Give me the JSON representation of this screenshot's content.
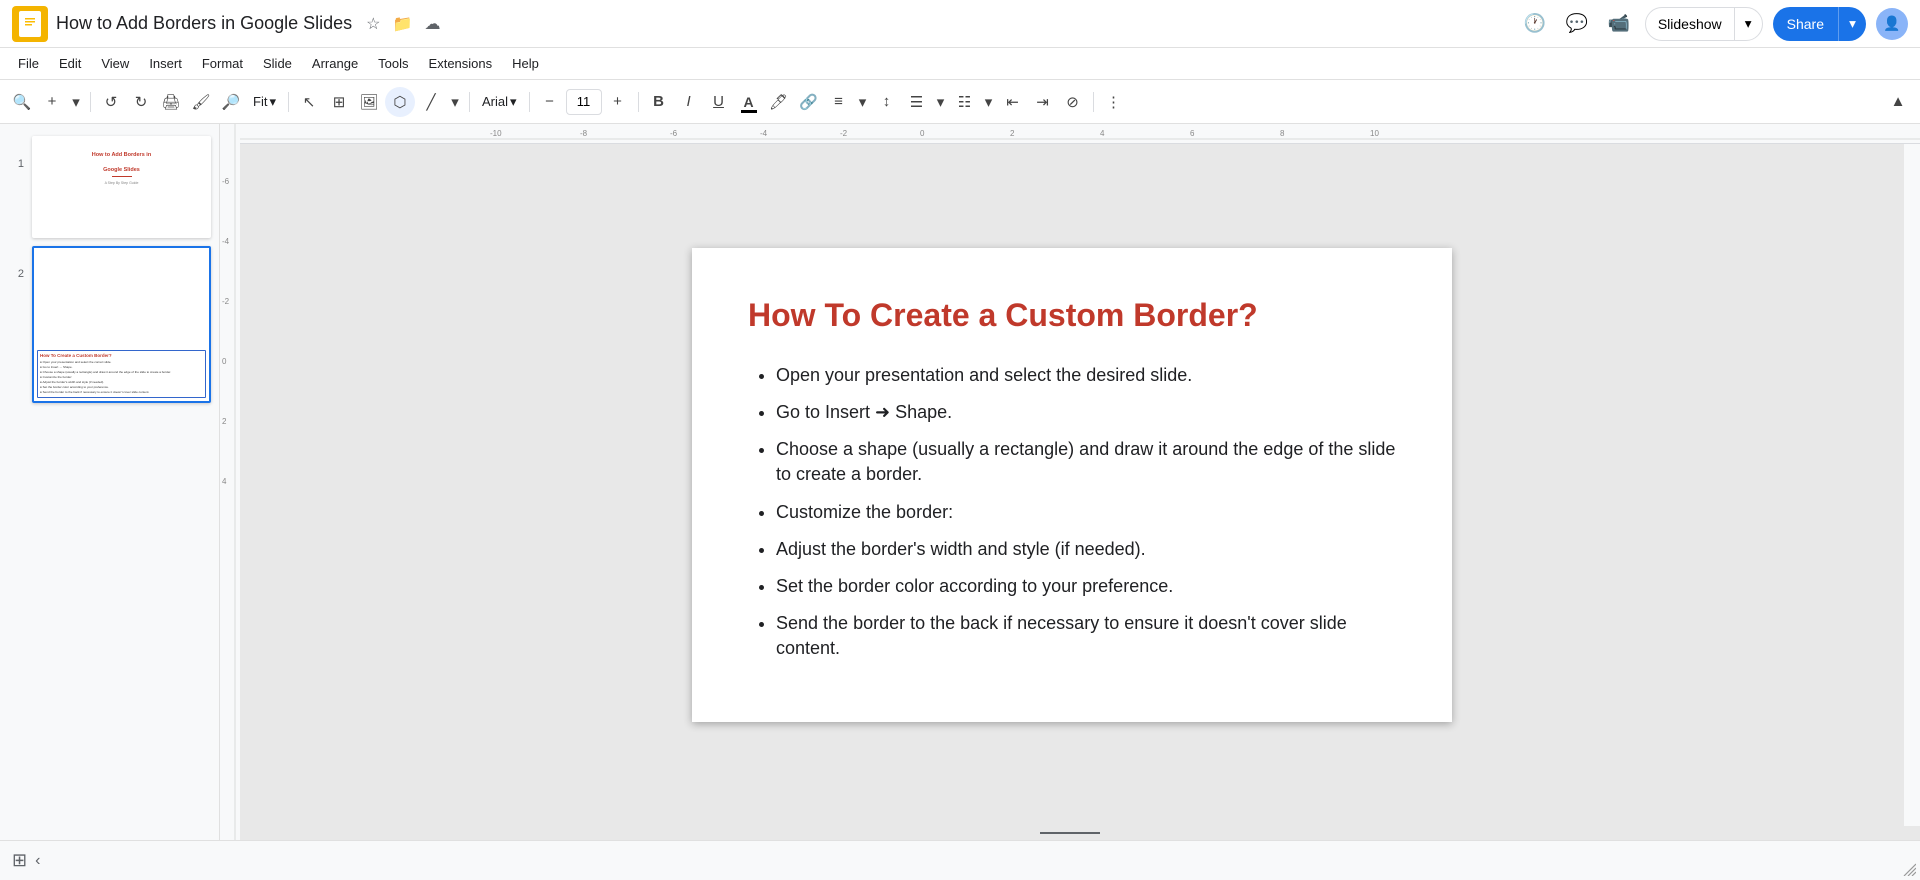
{
  "app": {
    "logo_color": "#f4b400",
    "title": "How to Add Borders in Google Slides",
    "title_star_tooltip": "Star",
    "title_folder_tooltip": "Move",
    "title_cloud_tooltip": "Sync"
  },
  "header": {
    "slideshow_label": "Slideshow",
    "share_label": "Share"
  },
  "menubar": {
    "items": [
      "File",
      "Edit",
      "View",
      "Insert",
      "Format",
      "Slide",
      "Arrange",
      "Tools",
      "Extensions",
      "Help"
    ]
  },
  "toolbar": {
    "zoom_label": "Fit",
    "font_label": "Arial",
    "font_size": "11",
    "bold_label": "B",
    "italic_label": "I",
    "underline_label": "U"
  },
  "slides": [
    {
      "num": "1",
      "title_line1": "How to Add Borders in",
      "title_line2": "Google Slides",
      "subtitle": "A Step By Step Guide"
    },
    {
      "num": "2",
      "title": "How To Create a Custom Border?",
      "bullets": [
        "Open your presentation and select the correct slide.",
        "Go to Insert → Shape.",
        "Choose a shape (usually a rectangle) and draw it around the edge of the slide to create a border.",
        "Customize the border:",
        "Adjust the border's width and style (if needed).",
        "Set the border color according to your preference.",
        "Send the border to the back if necessary to ensure it doesn't cover slide content."
      ]
    }
  ],
  "main_slide": {
    "title": "How To Create a Custom Border?",
    "bullets": [
      "Open your presentation and select the desired slide.",
      "Go to Insert → Shape.",
      "Choose a shape (usually a rectangle) and draw it around the edge of the slide to create a border.",
      "Customize the border:",
      "Adjust the border's width and style (if needed).",
      "Set the border color according to your preference.",
      "Send the border to the back if necessary to ensure it doesn't cover slide content."
    ]
  }
}
